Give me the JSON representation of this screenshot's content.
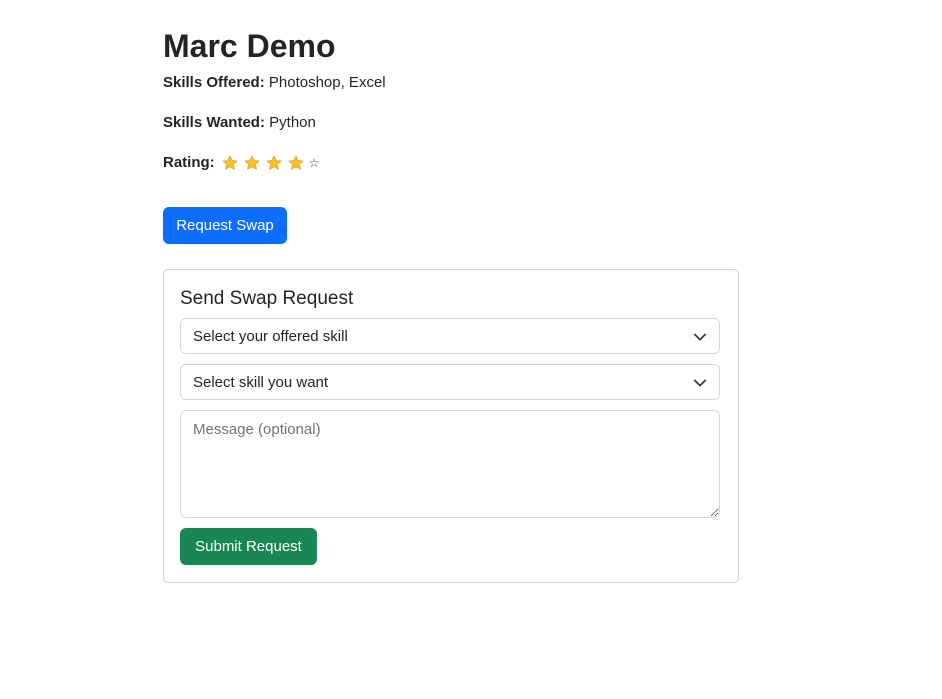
{
  "profile": {
    "name": "Marc Demo",
    "skills_offered_label": "Skills Offered:",
    "skills_offered_value": "Photoshop, Excel",
    "skills_wanted_label": "Skills Wanted:",
    "skills_wanted_value": "Python",
    "rating_label": "Rating:",
    "rating_value": 4,
    "rating_max": 5,
    "empty_star_glyph": "☆",
    "star_color": "#f4c430"
  },
  "actions": {
    "request_swap_label": "Request Swap"
  },
  "swap_form": {
    "title": "Send Swap Request",
    "offered_select_value": "Select your offered skill",
    "wanted_select_value": "Select skill you want",
    "message_placeholder": "Message (optional)",
    "submit_label": "Submit Request"
  },
  "colors": {
    "primary": "#0d6efd",
    "success": "#198754"
  }
}
